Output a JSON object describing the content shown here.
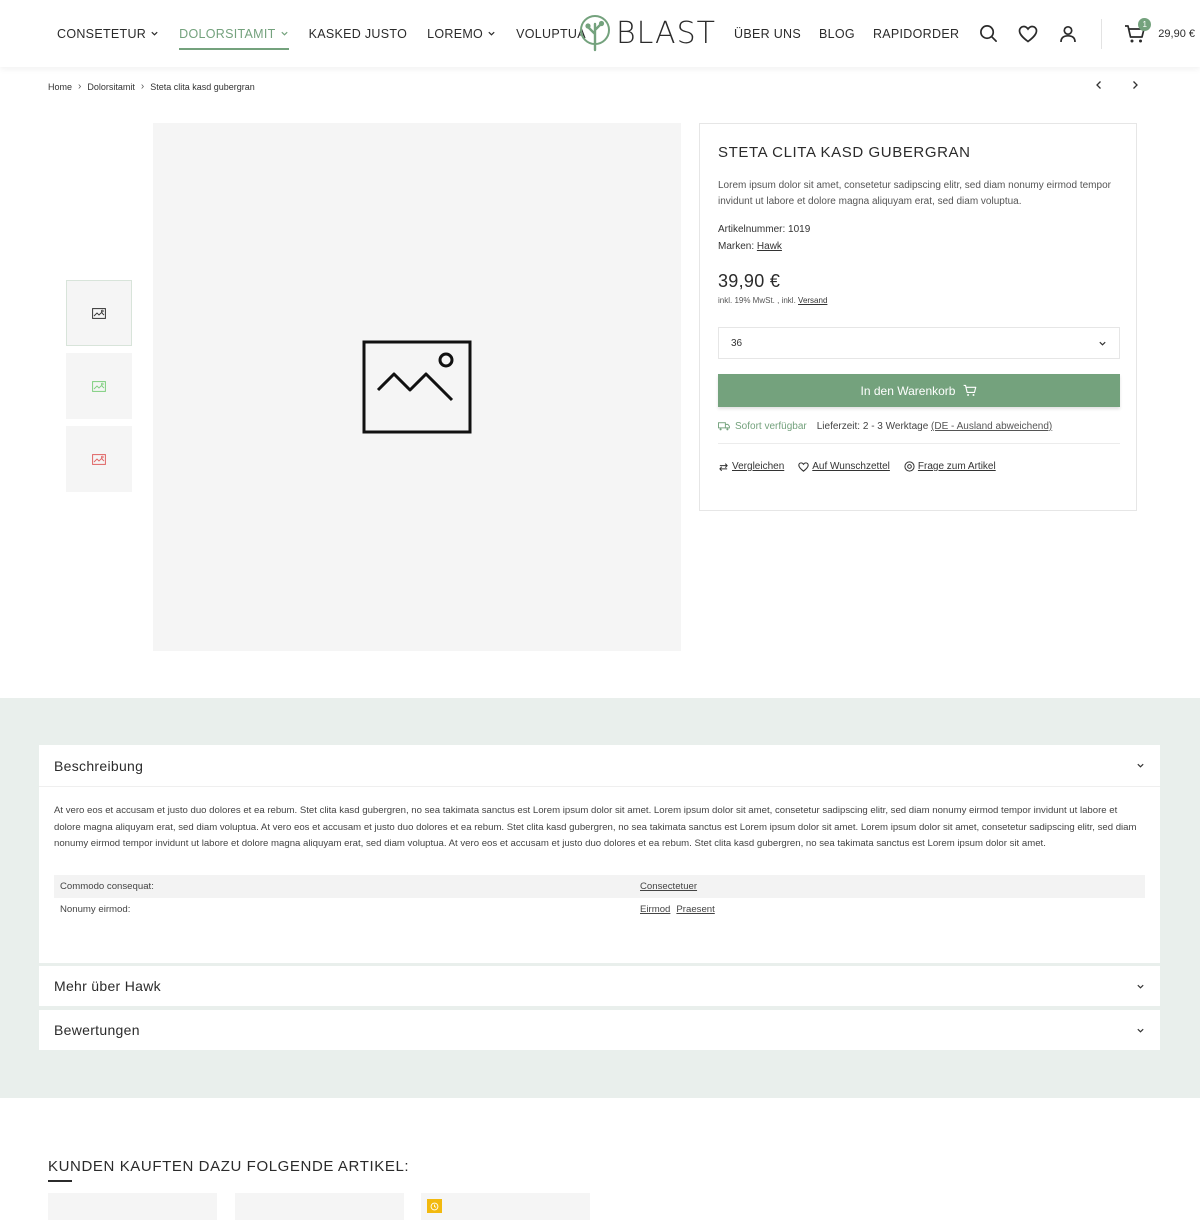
{
  "header": {
    "nav_left": [
      {
        "label": "CONSETETUR",
        "has_dropdown": true,
        "active": false
      },
      {
        "label": "DOLORSITAMIT",
        "has_dropdown": true,
        "active": true
      },
      {
        "label": "KASKED JUSTO",
        "has_dropdown": false,
        "active": false
      },
      {
        "label": "LOREMO",
        "has_dropdown": true,
        "active": false
      },
      {
        "label": "VOLUPTUA",
        "has_dropdown": false,
        "active": false
      }
    ],
    "logo_text": "BLAST",
    "nav_right": [
      "ÜBER UNS",
      "BLOG",
      "RAPIDORDER"
    ],
    "cart_count": "1",
    "cart_total": "29,90 €",
    "icons": [
      "search-icon",
      "heart-icon",
      "user-icon",
      "cart-icon"
    ]
  },
  "breadcrumb": [
    "Home",
    "Dolorsitamit",
    "Steta clita kasd gubergran"
  ],
  "product": {
    "title": "STETA CLITA KASD GUBERGRAN",
    "description": "Lorem ipsum dolor sit amet, consetetur sadipscing elitr, sed diam nonumy eirmod tempor invidunt ut labore et dolore magna aliquyam erat, sed diam voluptua.",
    "article_label": "Artikelnummer:",
    "article_number": "1019",
    "brand_label": "Marken:",
    "brand": "Hawk",
    "price": "39,90 €",
    "tax_text": "inkl. 19% MwSt. , inkl.",
    "shipping_link": "Versand",
    "size_selected": "36",
    "add_to_cart": "In den Warenkorb",
    "availability": "Sofort verfügbar",
    "delivery_time": "Lieferzeit: 2 - 3 Werktage",
    "delivery_link": "(DE - Ausland abweichend)",
    "actions": [
      "Vergleichen",
      "Auf Wunschzettel",
      "Frage zum Artikel"
    ]
  },
  "tabs": {
    "description_title": "Beschreibung",
    "description_text": "At vero eos et accusam et justo duo dolores et ea rebum. Stet clita kasd gubergren, no sea takimata sanctus est Lorem ipsum dolor sit amet. Lorem ipsum dolor sit amet, consetetur sadipscing elitr, sed diam nonumy eirmod tempor invidunt ut labore et dolore magna aliquyam erat, sed diam voluptua. At vero eos et accusam et justo duo dolores et ea rebum. Stet clita kasd gubergren, no sea takimata sanctus est Lorem ipsum dolor sit amet. Lorem ipsum dolor sit amet, consetetur sadipscing elitr, sed diam nonumy eirmod tempor invidunt ut labore et dolore magna aliquyam erat, sed diam voluptua. At vero eos et accusam et justo duo dolores et ea rebum. Stet clita kasd gubergren, no sea takimata sanctus est Lorem ipsum dolor sit amet.",
    "properties": [
      {
        "key": "Commodo consequat:",
        "values": [
          "Consectetuer"
        ]
      },
      {
        "key": "Nonumy eirmod:",
        "values": [
          "Eirmod",
          "Praesent"
        ]
      }
    ],
    "more_title": "Mehr über Hawk",
    "reviews_title": "Bewertungen"
  },
  "cross_selling": {
    "title": "KUNDEN KAUFTEN DAZU FOLGENDE ARTIKEL:"
  },
  "colors": {
    "accent": "#74a27d",
    "section_bg": "#e9efec",
    "badge": "#f2b90f"
  }
}
